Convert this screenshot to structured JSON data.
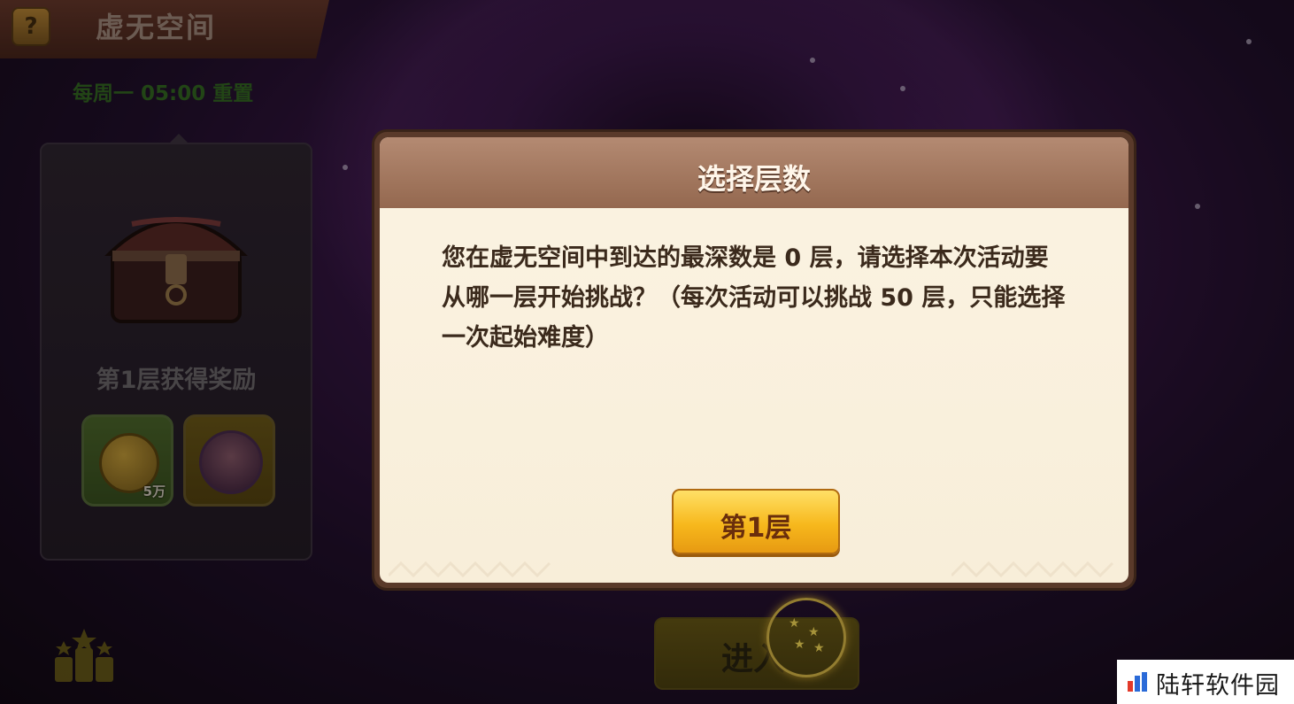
{
  "header": {
    "help_icon": "?",
    "title": "虚无空间",
    "reset_info": "每周一 05:00 重置"
  },
  "reward_panel": {
    "title": "第1层获得奖励",
    "items": [
      {
        "icon": "gold-coin-icon",
        "quantity": "5万"
      },
      {
        "icon": "character-portrait-icon",
        "quantity": ""
      }
    ]
  },
  "enter_button": {
    "label": "进入"
  },
  "modal": {
    "title": "选择层数",
    "message": "您在虚无空间中到达的最深数是 0 层，请选择本次活动要从哪一层开始挑战？（每次活动可以挑战 50 层，只能选择一次起始难度）",
    "floor_button": "第1层"
  },
  "watermark": {
    "text": "陆轩软件园"
  },
  "colors": {
    "accent": "#f7b81c",
    "modal_header": "#a47a62",
    "modal_body": "#fbf3e2"
  }
}
